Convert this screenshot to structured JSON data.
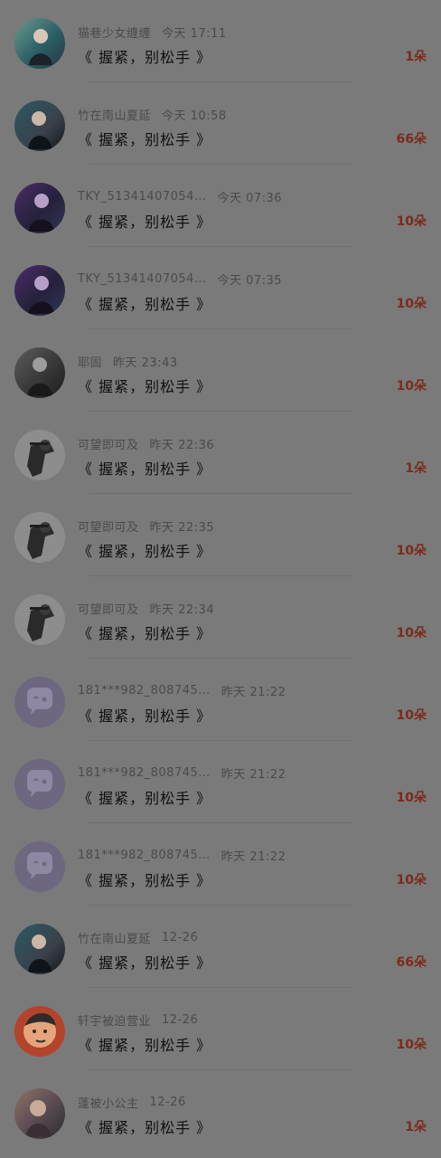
{
  "items": [
    {
      "name": "猫巷少女缠缠",
      "time": "今天 17:11",
      "gift": "《 握紧，别松手 》",
      "count": "1朵",
      "avatar_icon": "portrait-avatar-icon",
      "avatar_colors": [
        "#2b5f66",
        "#6c9a8f",
        "#283447"
      ]
    },
    {
      "name": "竹在南山夏延",
      "time": "今天 10:58",
      "gift": "《 握紧，别松手 》",
      "count": "66朵",
      "avatar_icon": "portrait-avatar-icon",
      "avatar_colors": [
        "#295a64",
        "#3a414a",
        "#111519"
      ]
    },
    {
      "name": "TKY_51341407054…",
      "time": "今天 07:36",
      "gift": "《 握紧，别松手 》",
      "count": "10朵",
      "avatar_icon": "portrait-avatar-icon",
      "avatar_colors": [
        "#4a2d6b",
        "#26213b",
        "#2f3756"
      ]
    },
    {
      "name": "TKY_51341407054…",
      "time": "今天 07:35",
      "gift": "《 握紧，别松手 》",
      "count": "10朵",
      "avatar_icon": "portrait-avatar-icon",
      "avatar_colors": [
        "#4a2d6b",
        "#26213b",
        "#2f3756"
      ]
    },
    {
      "name": "耶固",
      "time": "昨天 23:43",
      "gift": "《 握紧，别松手 》",
      "count": "10朵",
      "avatar_icon": "portrait-avatar-icon",
      "avatar_colors": [
        "#3b3b3b",
        "#5c5c5c",
        "#1d1d1d"
      ]
    },
    {
      "name": "可望即可及",
      "time": "昨天 22:36",
      "gift": "《 握紧，别松手 》",
      "count": "1朵",
      "avatar_icon": "portrait-avatar-icon",
      "avatar_colors": [
        "#5f5f5f",
        "#2b2b2b",
        "#9a9a9a"
      ]
    },
    {
      "name": "可望即可及",
      "time": "昨天 22:35",
      "gift": "《 握紧，别松手 》",
      "count": "10朵",
      "avatar_icon": "portrait-avatar-icon",
      "avatar_colors": [
        "#5f5f5f",
        "#2b2b2b",
        "#9a9a9a"
      ]
    },
    {
      "name": "可望即可及",
      "time": "昨天 22:34",
      "gift": "《 握紧，别松手 》",
      "count": "10朵",
      "avatar_icon": "portrait-avatar-icon",
      "avatar_colors": [
        "#5f5f5f",
        "#2b2b2b",
        "#9a9a9a"
      ]
    },
    {
      "name": "181***982_808745…",
      "time": "昨天 21:22",
      "gift": "《 握紧，别松手 》",
      "count": "10朵",
      "avatar_icon": "chat-bubble-avatar-icon",
      "avatar_colors": [
        "#6d6780",
        "#5d566f",
        "#7a7390"
      ]
    },
    {
      "name": "181***982_808745…",
      "time": "昨天 21:22",
      "gift": "《 握紧，别松手 》",
      "count": "10朵",
      "avatar_icon": "chat-bubble-avatar-icon",
      "avatar_colors": [
        "#6d6780",
        "#5d566f",
        "#7a7390"
      ]
    },
    {
      "name": "181***982_808745…",
      "time": "昨天 21:22",
      "gift": "《 握紧，别松手 》",
      "count": "10朵",
      "avatar_icon": "chat-bubble-avatar-icon",
      "avatar_colors": [
        "#6d6780",
        "#5d566f",
        "#7a7390"
      ]
    },
    {
      "name": "竹在南山夏延",
      "time": "12-26",
      "gift": "《 握紧，别松手 》",
      "count": "66朵",
      "avatar_icon": "portrait-avatar-icon",
      "avatar_colors": [
        "#295a64",
        "#3a414a",
        "#111519"
      ]
    },
    {
      "name": "轩宇被迫营业",
      "time": "12-26",
      "gift": "《 握紧，别松手 》",
      "count": "10朵",
      "avatar_icon": "cartoon-avatar-icon",
      "avatar_colors": [
        "#e6a47d",
        "#2f2a2b",
        "#b3442b"
      ]
    },
    {
      "name": "蓬被小公主",
      "time": "12-26",
      "gift": "《 握紧，别松手 》",
      "count": "1朵",
      "avatar_icon": "portrait-avatar-icon",
      "avatar_colors": [
        "#5c4c54",
        "#8f7466",
        "#2d2c33"
      ]
    }
  ]
}
